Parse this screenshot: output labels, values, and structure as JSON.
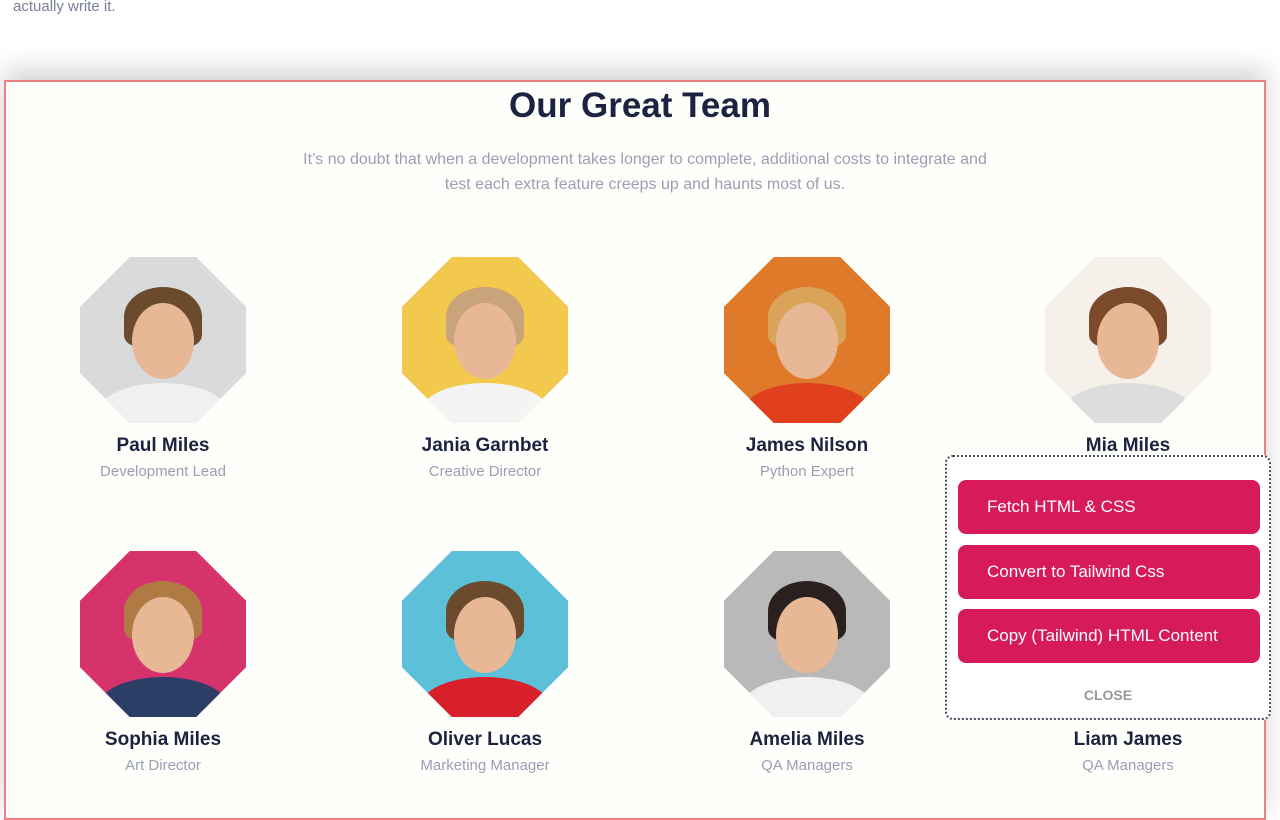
{
  "intro_text": "actually write it.",
  "section": {
    "title": "Our Great Team",
    "subtitle": "It’s no doubt that when a development takes longer to complete, additional costs to integrate and test each extra feature creeps up and haunts most of us."
  },
  "members": [
    {
      "name": "Paul Miles",
      "role": "Development Lead",
      "bg": "#d8dadb",
      "hair": "#6b4a2e",
      "shirt": "#f0f0f0"
    },
    {
      "name": "Jania Garnbet",
      "role": "Creative Director",
      "bg": "#f2c94c",
      "hair": "#c9a37a",
      "shirt": "#f4f4f4"
    },
    {
      "name": "James Nilson",
      "role": "Python Expert",
      "bg": "#e07a2b",
      "hair": "#d9a45a",
      "shirt": "#e0401e"
    },
    {
      "name": "Mia Miles",
      "role": "",
      "bg": "#f5f0ea",
      "hair": "#7a4a2a",
      "shirt": "#dddddd"
    },
    {
      "name": "Sophia Miles",
      "role": "Art Director",
      "bg": "#d6336c",
      "hair": "#b07a45",
      "shirt": "#2c3e66"
    },
    {
      "name": "Oliver Lucas",
      "role": "Marketing Manager",
      "bg": "#5bc0d8",
      "hair": "#6b4a2e",
      "shirt": "#d8202a"
    },
    {
      "name": "Amelia Miles",
      "role": "QA Managers",
      "bg": "#b9b9b9",
      "hair": "#2a2020",
      "shirt": "#f0f0f0"
    },
    {
      "name": "Liam James",
      "role": "QA Managers",
      "bg": "#ffffff",
      "hair": "#ffffff",
      "shirt": "#ffffff"
    }
  ],
  "popup": {
    "buttons": [
      "Fetch HTML & CSS",
      "Convert to Tailwind Css",
      "Copy (Tailwind) HTML Content"
    ],
    "close": "CLOSE",
    "accent": "#d61a5c"
  }
}
